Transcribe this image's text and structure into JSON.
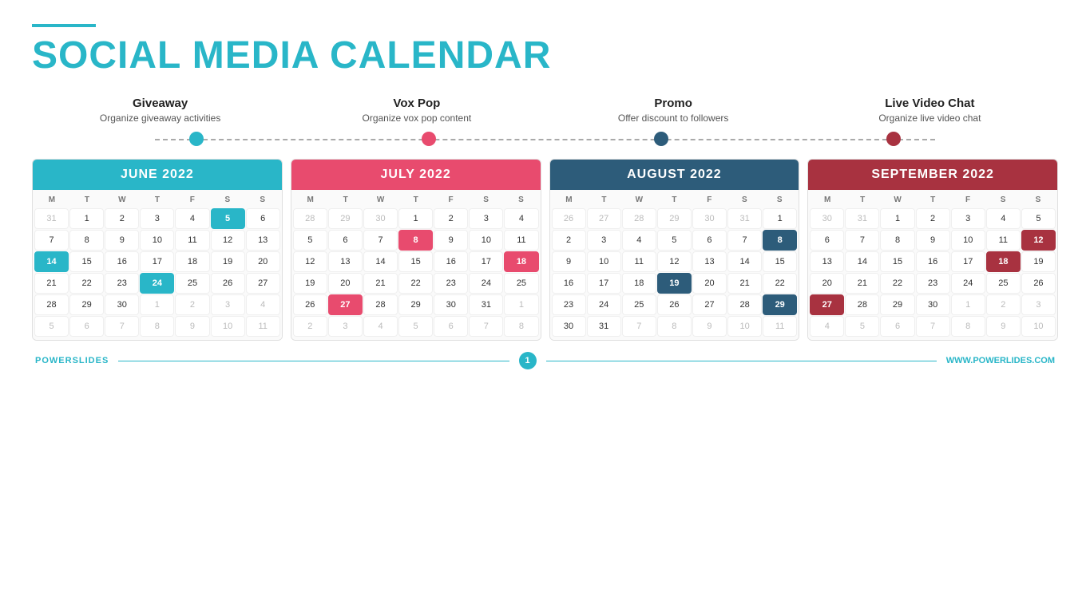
{
  "title": {
    "line1": "SOCIAL MEDIA ",
    "line1_accent": "CALENDAR",
    "accent_color": "#29b6c8"
  },
  "categories": [
    {
      "id": "giveaway",
      "title": "Giveaway",
      "desc": "Organize giveaway activities",
      "dot_class": "dot-teal"
    },
    {
      "id": "voxpop",
      "title": "Vox Pop",
      "desc": "Organize vox pop content",
      "dot_class": "dot-red"
    },
    {
      "id": "promo",
      "title": "Promo",
      "desc": "Offer discount to followers",
      "dot_class": "dot-dark"
    },
    {
      "id": "livevideo",
      "title": "Live Video Chat",
      "desc": "Organize live video chat",
      "dot_class": "dot-darkred"
    }
  ],
  "calendars": [
    {
      "id": "june2022",
      "month": "JUNE 2022",
      "header_class": "cal-header-teal",
      "days": [
        "M",
        "T",
        "W",
        "T",
        "F",
        "S",
        "S"
      ],
      "weeks": [
        [
          {
            "n": "31",
            "cls": "other-month"
          },
          {
            "n": "1",
            "cls": ""
          },
          {
            "n": "2",
            "cls": ""
          },
          {
            "n": "3",
            "cls": ""
          },
          {
            "n": "4",
            "cls": ""
          },
          {
            "n": "5",
            "cls": "highlight-teal"
          },
          {
            "n": "6",
            "cls": ""
          }
        ],
        [
          {
            "n": "7",
            "cls": ""
          },
          {
            "n": "8",
            "cls": ""
          },
          {
            "n": "9",
            "cls": ""
          },
          {
            "n": "10",
            "cls": ""
          },
          {
            "n": "11",
            "cls": ""
          },
          {
            "n": "12",
            "cls": ""
          },
          {
            "n": "13",
            "cls": ""
          }
        ],
        [
          {
            "n": "14",
            "cls": "highlight-teal"
          },
          {
            "n": "15",
            "cls": ""
          },
          {
            "n": "16",
            "cls": ""
          },
          {
            "n": "17",
            "cls": ""
          },
          {
            "n": "18",
            "cls": ""
          },
          {
            "n": "19",
            "cls": ""
          },
          {
            "n": "20",
            "cls": ""
          }
        ],
        [
          {
            "n": "21",
            "cls": ""
          },
          {
            "n": "22",
            "cls": ""
          },
          {
            "n": "23",
            "cls": ""
          },
          {
            "n": "24",
            "cls": "highlight-teal"
          },
          {
            "n": "25",
            "cls": ""
          },
          {
            "n": "26",
            "cls": ""
          },
          {
            "n": "27",
            "cls": ""
          }
        ],
        [
          {
            "n": "28",
            "cls": ""
          },
          {
            "n": "29",
            "cls": ""
          },
          {
            "n": "30",
            "cls": ""
          },
          {
            "n": "1",
            "cls": "other-month"
          },
          {
            "n": "2",
            "cls": "other-month"
          },
          {
            "n": "3",
            "cls": "other-month"
          },
          {
            "n": "4",
            "cls": "other-month"
          }
        ],
        [
          {
            "n": "5",
            "cls": "other-month"
          },
          {
            "n": "6",
            "cls": "other-month"
          },
          {
            "n": "7",
            "cls": "other-month"
          },
          {
            "n": "8",
            "cls": "other-month"
          },
          {
            "n": "9",
            "cls": "other-month"
          },
          {
            "n": "10",
            "cls": "other-month"
          },
          {
            "n": "11",
            "cls": "other-month"
          }
        ]
      ]
    },
    {
      "id": "july2022",
      "month": "JULY 2022",
      "header_class": "cal-header-red",
      "days": [
        "M",
        "T",
        "W",
        "T",
        "F",
        "S",
        "S"
      ],
      "weeks": [
        [
          {
            "n": "28",
            "cls": "other-month"
          },
          {
            "n": "29",
            "cls": "other-month"
          },
          {
            "n": "30",
            "cls": "other-month"
          },
          {
            "n": "1",
            "cls": ""
          },
          {
            "n": "2",
            "cls": ""
          },
          {
            "n": "3",
            "cls": ""
          },
          {
            "n": "4",
            "cls": ""
          }
        ],
        [
          {
            "n": "5",
            "cls": ""
          },
          {
            "n": "6",
            "cls": ""
          },
          {
            "n": "7",
            "cls": ""
          },
          {
            "n": "8",
            "cls": "highlight-red"
          },
          {
            "n": "9",
            "cls": ""
          },
          {
            "n": "10",
            "cls": ""
          },
          {
            "n": "11",
            "cls": ""
          }
        ],
        [
          {
            "n": "12",
            "cls": ""
          },
          {
            "n": "13",
            "cls": ""
          },
          {
            "n": "14",
            "cls": ""
          },
          {
            "n": "15",
            "cls": ""
          },
          {
            "n": "16",
            "cls": ""
          },
          {
            "n": "17",
            "cls": ""
          },
          {
            "n": "18",
            "cls": "highlight-red"
          }
        ],
        [
          {
            "n": "19",
            "cls": ""
          },
          {
            "n": "20",
            "cls": ""
          },
          {
            "n": "21",
            "cls": ""
          },
          {
            "n": "22",
            "cls": ""
          },
          {
            "n": "23",
            "cls": ""
          },
          {
            "n": "24",
            "cls": ""
          },
          {
            "n": "25",
            "cls": ""
          }
        ],
        [
          {
            "n": "26",
            "cls": ""
          },
          {
            "n": "27",
            "cls": "highlight-red"
          },
          {
            "n": "28",
            "cls": ""
          },
          {
            "n": "29",
            "cls": ""
          },
          {
            "n": "30",
            "cls": ""
          },
          {
            "n": "31",
            "cls": ""
          },
          {
            "n": "1",
            "cls": "other-month"
          }
        ],
        [
          {
            "n": "2",
            "cls": "other-month"
          },
          {
            "n": "3",
            "cls": "other-month"
          },
          {
            "n": "4",
            "cls": "other-month"
          },
          {
            "n": "5",
            "cls": "other-month"
          },
          {
            "n": "6",
            "cls": "other-month"
          },
          {
            "n": "7",
            "cls": "other-month"
          },
          {
            "n": "8",
            "cls": "other-month"
          }
        ]
      ]
    },
    {
      "id": "august2022",
      "month": "AUGUST 2022",
      "header_class": "cal-header-dark",
      "days": [
        "M",
        "T",
        "W",
        "T",
        "F",
        "S",
        "S"
      ],
      "weeks": [
        [
          {
            "n": "26",
            "cls": "other-month"
          },
          {
            "n": "27",
            "cls": "other-month"
          },
          {
            "n": "28",
            "cls": "other-month"
          },
          {
            "n": "29",
            "cls": "other-month"
          },
          {
            "n": "30",
            "cls": "other-month"
          },
          {
            "n": "31",
            "cls": "other-month"
          },
          {
            "n": "1",
            "cls": ""
          }
        ],
        [
          {
            "n": "2",
            "cls": ""
          },
          {
            "n": "3",
            "cls": ""
          },
          {
            "n": "4",
            "cls": ""
          },
          {
            "n": "5",
            "cls": ""
          },
          {
            "n": "6",
            "cls": ""
          },
          {
            "n": "7",
            "cls": ""
          },
          {
            "n": "8",
            "cls": "highlight-dark"
          }
        ],
        [
          {
            "n": "9",
            "cls": ""
          },
          {
            "n": "10",
            "cls": ""
          },
          {
            "n": "11",
            "cls": ""
          },
          {
            "n": "12",
            "cls": ""
          },
          {
            "n": "13",
            "cls": ""
          },
          {
            "n": "14",
            "cls": ""
          },
          {
            "n": "15",
            "cls": ""
          }
        ],
        [
          {
            "n": "16",
            "cls": ""
          },
          {
            "n": "17",
            "cls": ""
          },
          {
            "n": "18",
            "cls": ""
          },
          {
            "n": "19",
            "cls": "highlight-dark"
          },
          {
            "n": "20",
            "cls": ""
          },
          {
            "n": "21",
            "cls": ""
          },
          {
            "n": "22",
            "cls": ""
          }
        ],
        [
          {
            "n": "23",
            "cls": ""
          },
          {
            "n": "24",
            "cls": ""
          },
          {
            "n": "25",
            "cls": ""
          },
          {
            "n": "26",
            "cls": ""
          },
          {
            "n": "27",
            "cls": ""
          },
          {
            "n": "28",
            "cls": ""
          },
          {
            "n": "29",
            "cls": "highlight-dark"
          }
        ],
        [
          {
            "n": "30",
            "cls": ""
          },
          {
            "n": "31",
            "cls": ""
          },
          {
            "n": "7",
            "cls": "other-month"
          },
          {
            "n": "8",
            "cls": "other-month"
          },
          {
            "n": "9",
            "cls": "other-month"
          },
          {
            "n": "10",
            "cls": "other-month"
          },
          {
            "n": "11",
            "cls": "other-month"
          }
        ]
      ]
    },
    {
      "id": "september2022",
      "month": "SEPTEMBER 2022",
      "header_class": "cal-header-darkred",
      "days": [
        "M",
        "T",
        "W",
        "T",
        "F",
        "S",
        "S"
      ],
      "weeks": [
        [
          {
            "n": "30",
            "cls": "other-month"
          },
          {
            "n": "31",
            "cls": "other-month"
          },
          {
            "n": "1",
            "cls": ""
          },
          {
            "n": "2",
            "cls": ""
          },
          {
            "n": "3",
            "cls": ""
          },
          {
            "n": "4",
            "cls": ""
          },
          {
            "n": "5",
            "cls": ""
          }
        ],
        [
          {
            "n": "6",
            "cls": ""
          },
          {
            "n": "7",
            "cls": ""
          },
          {
            "n": "8",
            "cls": ""
          },
          {
            "n": "9",
            "cls": ""
          },
          {
            "n": "10",
            "cls": ""
          },
          {
            "n": "11",
            "cls": ""
          },
          {
            "n": "12",
            "cls": "highlight-darkred"
          }
        ],
        [
          {
            "n": "13",
            "cls": ""
          },
          {
            "n": "14",
            "cls": ""
          },
          {
            "n": "15",
            "cls": ""
          },
          {
            "n": "16",
            "cls": ""
          },
          {
            "n": "17",
            "cls": ""
          },
          {
            "n": "18",
            "cls": "highlight-darkred"
          },
          {
            "n": "19",
            "cls": ""
          }
        ],
        [
          {
            "n": "20",
            "cls": ""
          },
          {
            "n": "21",
            "cls": ""
          },
          {
            "n": "22",
            "cls": ""
          },
          {
            "n": "23",
            "cls": ""
          },
          {
            "n": "24",
            "cls": ""
          },
          {
            "n": "25",
            "cls": ""
          },
          {
            "n": "26",
            "cls": ""
          }
        ],
        [
          {
            "n": "27",
            "cls": "highlight-darkred"
          },
          {
            "n": "28",
            "cls": ""
          },
          {
            "n": "29",
            "cls": ""
          },
          {
            "n": "30",
            "cls": ""
          },
          {
            "n": "1",
            "cls": "other-month"
          },
          {
            "n": "2",
            "cls": "other-month"
          },
          {
            "n": "3",
            "cls": "other-month"
          }
        ],
        [
          {
            "n": "4",
            "cls": "other-month"
          },
          {
            "n": "5",
            "cls": "other-month"
          },
          {
            "n": "6",
            "cls": "other-month"
          },
          {
            "n": "7",
            "cls": "other-month"
          },
          {
            "n": "8",
            "cls": "other-month"
          },
          {
            "n": "9",
            "cls": "other-month"
          },
          {
            "n": "10",
            "cls": "other-month"
          }
        ]
      ]
    }
  ],
  "footer": {
    "brand": "POWER",
    "brand_accent": "SLIDES",
    "page_num": "1",
    "website": "WWW.POWERLIDES.COM"
  }
}
